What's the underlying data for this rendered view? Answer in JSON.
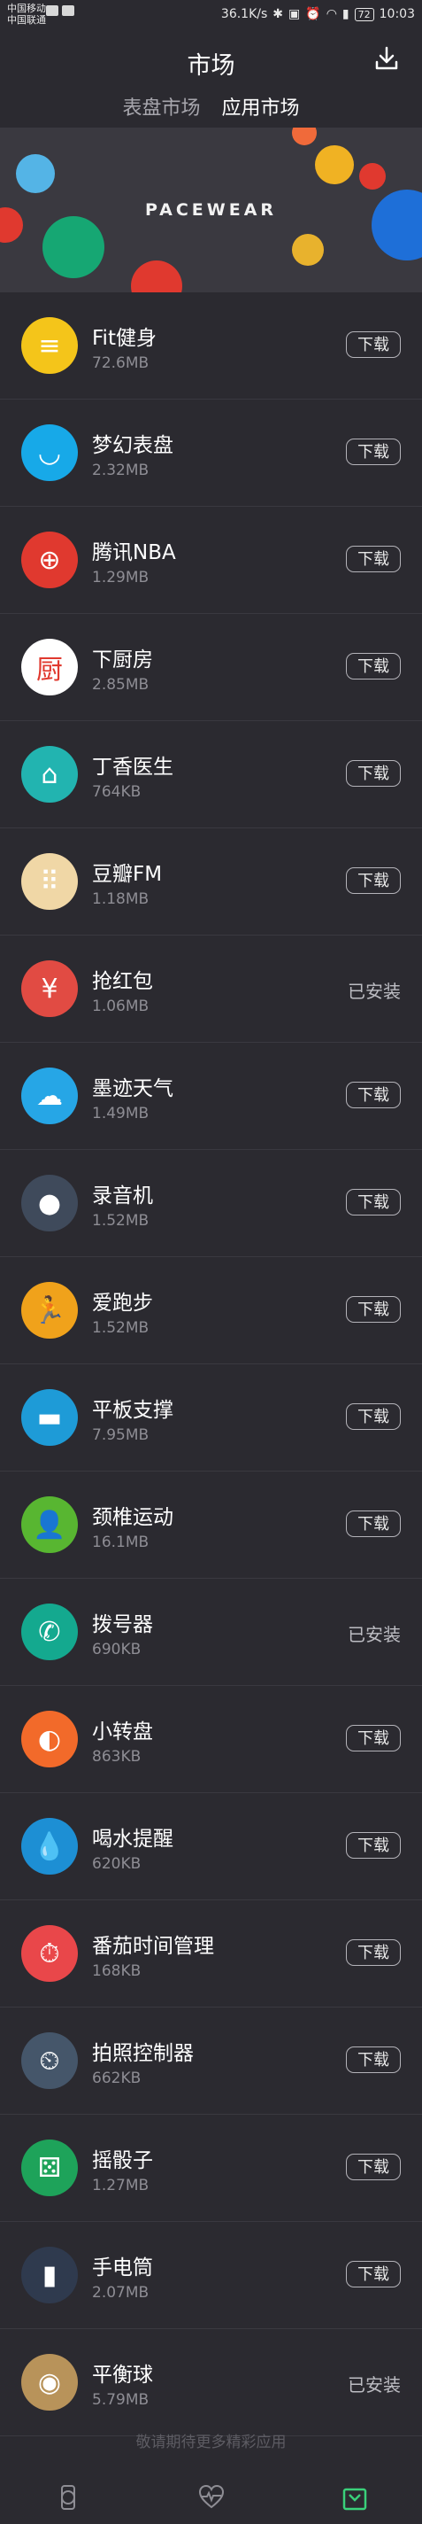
{
  "status_bar": {
    "carrier_1": "中国移动",
    "carrier_2": "中国联通",
    "speed": "36.1K/s",
    "battery": "72",
    "time": "10:03"
  },
  "header": {
    "title": "市场",
    "tabs": [
      {
        "label": "表盘市场",
        "active": false
      },
      {
        "label": "应用市场",
        "active": true
      }
    ],
    "active_indicator_color": "#3ad07a"
  },
  "banner": {
    "text": "PACEWEAR"
  },
  "apps": [
    {
      "name": "Fit健身",
      "size": "72.6MB",
      "action": "下载",
      "icon": "fit-fitness-icon",
      "color": "#f4c51a"
    },
    {
      "name": "梦幻表盘",
      "size": "2.32MB",
      "action": "下载",
      "icon": "dream-watchface-icon",
      "color": "#17a9e8"
    },
    {
      "name": "腾讯NBA",
      "size": "1.29MB",
      "action": "下载",
      "icon": "basketball-icon",
      "color": "#e0392f"
    },
    {
      "name": "下厨房",
      "size": "2.85MB",
      "action": "下载",
      "icon": "kitchen-icon",
      "color": "#ffffff"
    },
    {
      "name": "丁香医生",
      "size": "764KB",
      "action": "下载",
      "icon": "doctor-house-icon",
      "color": "#22b4b0"
    },
    {
      "name": "豆瓣FM",
      "size": "1.18MB",
      "action": "下载",
      "icon": "radio-icon",
      "color": "#f0d7a6"
    },
    {
      "name": "抢红包",
      "size": "1.06MB",
      "action": "已安装",
      "icon": "red-envelope-icon",
      "color": "#e14b43"
    },
    {
      "name": "墨迹天气",
      "size": "1.49MB",
      "action": "下载",
      "icon": "weather-icon",
      "color": "#26a6e6"
    },
    {
      "name": "录音机",
      "size": "1.52MB",
      "action": "下载",
      "icon": "recorder-icon",
      "color": "#3f4a5b"
    },
    {
      "name": "爱跑步",
      "size": "1.52MB",
      "action": "下载",
      "icon": "running-icon",
      "color": "#f0a21b"
    },
    {
      "name": "平板支撑",
      "size": "7.95MB",
      "action": "下载",
      "icon": "plank-icon",
      "color": "#1e9bd7"
    },
    {
      "name": "颈椎运动",
      "size": "16.1MB",
      "action": "下载",
      "icon": "neck-exercise-icon",
      "color": "#58b631"
    },
    {
      "name": "拨号器",
      "size": "690KB",
      "action": "已安装",
      "icon": "phone-icon",
      "color": "#14a98f"
    },
    {
      "name": "小转盘",
      "size": "863KB",
      "action": "下载",
      "icon": "spinner-wheel-icon",
      "color": "#f26a2a"
    },
    {
      "name": "喝水提醒",
      "size": "620KB",
      "action": "下载",
      "icon": "water-drop-icon",
      "color": "#1d8fd4"
    },
    {
      "name": "番茄时间管理",
      "size": "168KB",
      "action": "下载",
      "icon": "tomato-timer-icon",
      "color": "#e9474a"
    },
    {
      "name": "拍照控制器",
      "size": "662KB",
      "action": "下载",
      "icon": "camera-control-icon",
      "color": "#45566a"
    },
    {
      "name": "摇骰子",
      "size": "1.27MB",
      "action": "下载",
      "icon": "dice-icon",
      "color": "#1ea35a"
    },
    {
      "name": "手电筒",
      "size": "2.07MB",
      "action": "下载",
      "icon": "flashlight-icon",
      "color": "#2f3a4e"
    },
    {
      "name": "平衡球",
      "size": "5.79MB",
      "action": "已安装",
      "icon": "balance-ball-icon",
      "color": "#b8935a"
    }
  ],
  "footer": {
    "tip": "敬请期待更多精彩应用"
  },
  "bottom_nav": [
    {
      "icon": "watch-icon",
      "active": false
    },
    {
      "icon": "heart-rate-icon",
      "active": false
    },
    {
      "icon": "market-bag-icon",
      "active": true
    }
  ]
}
